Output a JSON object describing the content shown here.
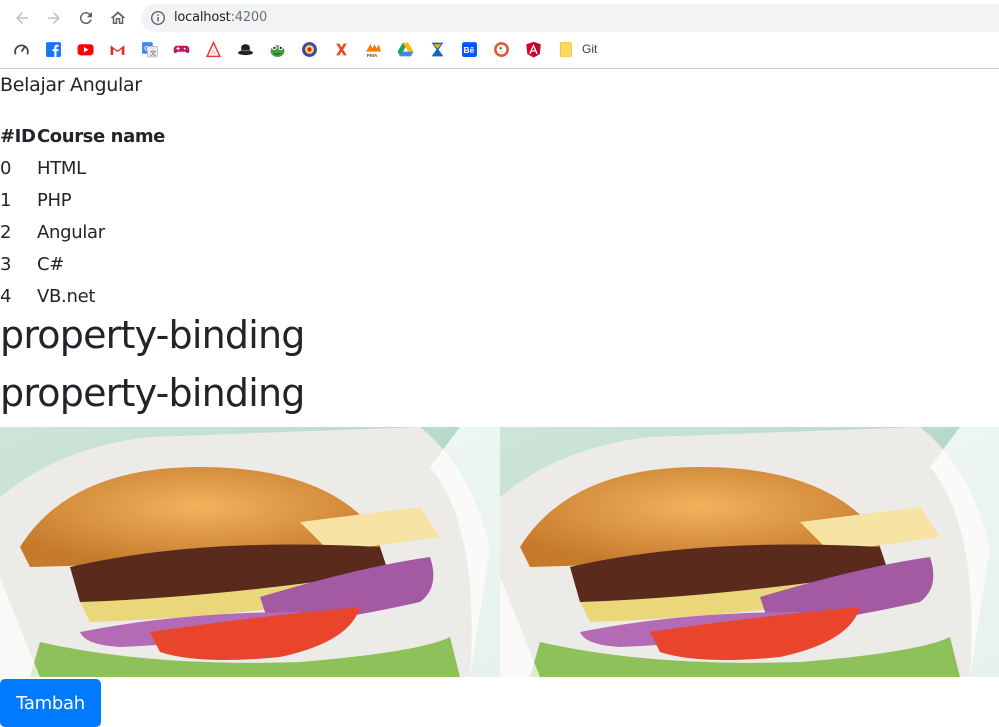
{
  "browser": {
    "url_host": "localhost",
    "url_port": ":4200",
    "bookmarks": [
      {
        "icon": "speed-dial-icon",
        "color": "#5f6368"
      },
      {
        "icon": "facebook-icon",
        "color": "#1877f2"
      },
      {
        "icon": "youtube-icon",
        "color": "#ff0000"
      },
      {
        "icon": "gmail-icon",
        "color": "#d93025"
      },
      {
        "icon": "google-translate-icon",
        "color": "#4285f4"
      },
      {
        "icon": "gamepad-icon",
        "color": "#c2185b"
      },
      {
        "icon": "triangle-icon",
        "color": "#e53935"
      },
      {
        "icon": "hat-icon",
        "color": "#212121"
      },
      {
        "icon": "frog-icon",
        "color": "#43a047"
      },
      {
        "icon": "badge-icon",
        "color": "#3949ab"
      },
      {
        "icon": "x-icon",
        "color": "#e64a19"
      },
      {
        "icon": "pma-icon",
        "color": "#f57c00"
      },
      {
        "icon": "google-drive-icon",
        "color": "#1fa463"
      },
      {
        "icon": "hourglass-icon",
        "color": "#1565c0"
      },
      {
        "icon": "behance-icon",
        "color": "#0057ff"
      },
      {
        "icon": "duckduckgo-icon",
        "color": "#de5833"
      },
      {
        "icon": "angular-icon",
        "color": "#dd0031"
      },
      {
        "icon": "folder-icon",
        "color": "#fdd663"
      }
    ],
    "bookmark_git_label": "Git"
  },
  "app": {
    "title": "Belajar Angular",
    "table": {
      "headers": [
        "#ID",
        "Course name"
      ],
      "rows": [
        {
          "id": "0",
          "name": "HTML"
        },
        {
          "id": "1",
          "name": "PHP"
        },
        {
          "id": "2",
          "name": "Angular"
        },
        {
          "id": "3",
          "name": "C#"
        },
        {
          "id": "4",
          "name": "VB.net"
        }
      ]
    },
    "headings": [
      "property-binding",
      "property-binding"
    ],
    "button_label": "Tambah",
    "colors": {
      "primary": "#007bff",
      "text": "#212529"
    }
  }
}
